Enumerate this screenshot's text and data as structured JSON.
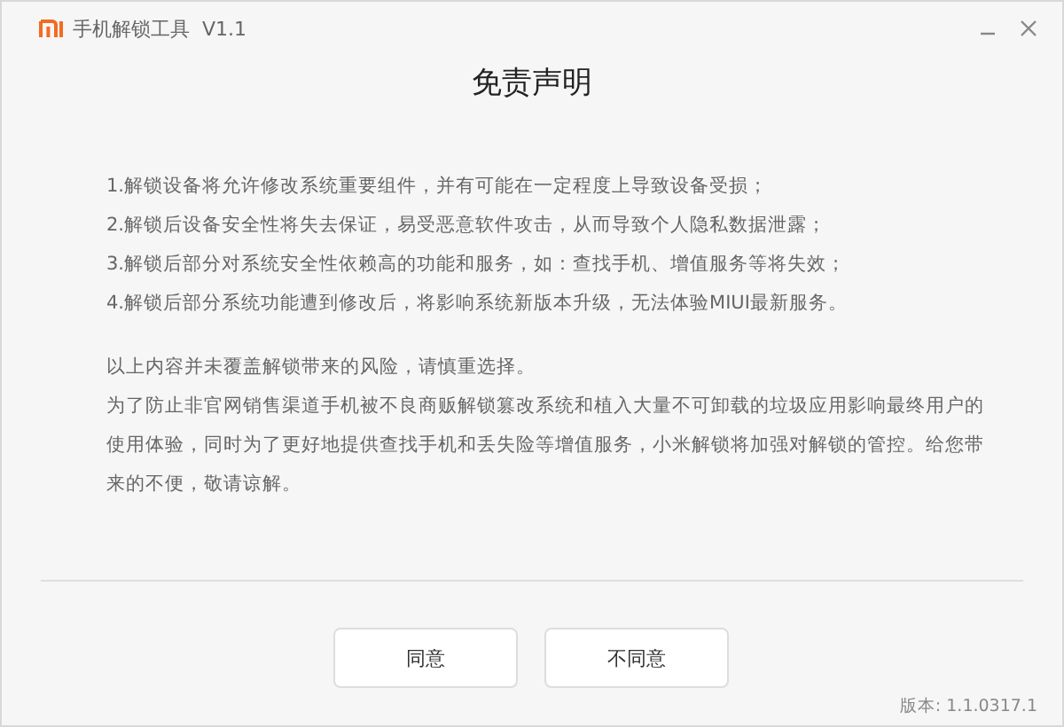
{
  "window": {
    "title": "手机解锁工具  V1.1"
  },
  "heading": "免责声明",
  "risks": [
    "1.解锁设备将允许修改系统重要组件，并有可能在一定程度上导致设备受损；",
    "2.解锁后设备安全性将失去保证，易受恶意软件攻击，从而导致个人隐私数据泄露；",
    "3.解锁后部分对系统安全性依赖高的功能和服务，如：查找手机、增值服务等将失效；",
    "4.解锁后部分系统功能遭到修改后，将影响系统新版本升级，无法体验MIUI最新服务。"
  ],
  "notes": [
    "以上内容并未覆盖解锁带来的风险，请慎重选择。",
    "为了防止非官网销售渠道手机被不良商贩解锁篡改系统和植入大量不可卸载的垃圾应用影响最终用户的使用体验，同时为了更好地提供查找手机和丢失险等增值服务，小米解锁将加强对解锁的管控。给您带来的不便，敬请谅解。"
  ],
  "buttons": [
    "同意",
    "不同意"
  ],
  "version": "版本: 1.1.0317.1"
}
